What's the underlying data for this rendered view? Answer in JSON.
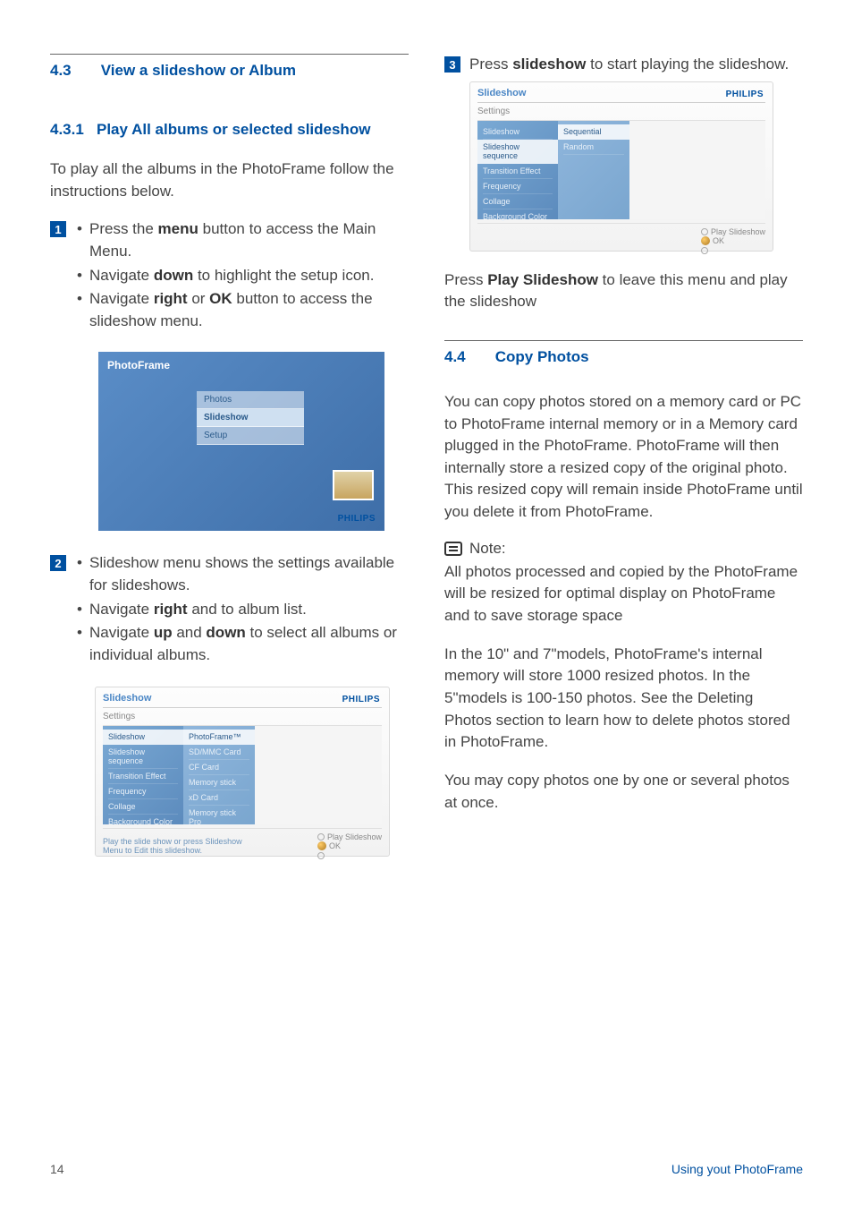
{
  "left": {
    "sec43": {
      "num": "4.3",
      "title": "View a slideshow or Album"
    },
    "sec431": {
      "num": "4.3.1",
      "title": "Play All albums or selected slideshow"
    },
    "intro": "To play all the albums in the PhotoFrame follow the instructions below.",
    "step1": {
      "num": "1",
      "b1a": "Press the ",
      "b1b": "menu",
      "b1c": " button to access the Main Menu.",
      "b2a": "Navigate ",
      "b2b": "down",
      "b2c": " to highlight the setup icon.",
      "b3a": "Navigate ",
      "b3b": "right",
      "b3c": " or ",
      "b3d": "OK",
      "b3e": " button to access the slideshow menu."
    },
    "shot1": {
      "pf": "PhotoFrame",
      "m1": "Photos",
      "m2": "Slideshow",
      "m3": "Setup",
      "brand": "PHILIPS"
    },
    "step2": {
      "num": "2",
      "b1": "Slideshow menu shows the settings available for slideshows.",
      "b2a": "Navigate ",
      "b2b": "right",
      "b2c": " and to album list.",
      "b3a": "Navigate ",
      "b3b": "up",
      "b3c": " and ",
      "b3d": "down",
      "b3e": " to select all albums or individual albums."
    },
    "shot2": {
      "title": "Slideshow",
      "sub": "Settings",
      "brand": "PHILIPS",
      "left": [
        "Slideshow",
        "Slideshow sequence",
        "Transition Effect",
        "Frequency",
        "Collage",
        "Background Color"
      ],
      "mid": [
        "PhotoFrame™",
        "SD/MMC Card",
        "CF Card",
        "Memory stick",
        "xD Card",
        "Memory stick Pro"
      ],
      "foot_left": "Play the slide show or press Slideshow Menu to Edit this slideshow.",
      "foot_r1": "Play Slideshow",
      "foot_r2": "OK"
    }
  },
  "right": {
    "step3": {
      "num": "3",
      "a": "Press ",
      "b": "slideshow",
      "c": " to start playing the slideshow."
    },
    "shot3": {
      "title": "Slideshow",
      "sub": "Settings",
      "brand": "PHILIPS",
      "left": [
        "Slideshow",
        "Slideshow sequence",
        "Transition Effect",
        "Frequency",
        "Collage",
        "Background Color"
      ],
      "mid": [
        "Sequential",
        "Random"
      ],
      "foot_r1": "Play Slideshow",
      "foot_r2": "OK"
    },
    "press_play_a": "Press ",
    "press_play_b": "Play Slideshow",
    "press_play_c": " to leave this menu and play the slideshow",
    "sec44": {
      "num": "4.4",
      "title": "Copy Photos"
    },
    "p1": "You can copy photos stored on a memory card or PC to PhotoFrame internal memory or in a Memory card plugged in the PhotoFrame. PhotoFrame will then internally store a resized copy of the original photo. This resized copy will remain inside PhotoFrame until you delete it from PhotoFrame.",
    "note_label": "Note:",
    "note_body": "All photos processed and copied by the PhotoFrame will be resized for optimal display on PhotoFrame and to save storage space",
    "p2": "In the 10\" and  7\"models, PhotoFrame's internal memory will store 1000 resized photos.  In the 5\"models is 100-150 photos. See the Deleting Photos section to learn how to delete photos stored in PhotoFrame.",
    "p3": "You may copy photos one by one or several photos at once."
  },
  "footer": {
    "page": "14",
    "label": "Using yout PhotoFrame"
  }
}
